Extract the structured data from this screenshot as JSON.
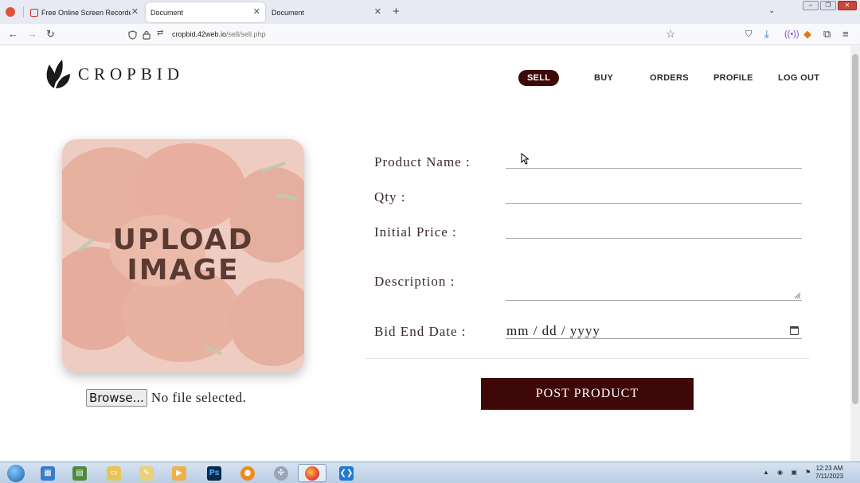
{
  "browser": {
    "tabs": [
      {
        "label": "Free Online Screen Recorder & ...",
        "active": false
      },
      {
        "label": "Document",
        "active": true
      },
      {
        "label": "Document",
        "active": false
      }
    ],
    "url_host": "cropbid.42web.io",
    "url_path": "/sell/sell.php"
  },
  "site": {
    "brand": "CROPBID",
    "nav": [
      {
        "label": "SELL",
        "active": true
      },
      {
        "label": "BUY",
        "active": false
      },
      {
        "label": "ORDERS",
        "active": false
      },
      {
        "label": "PROFILE",
        "active": false
      },
      {
        "label": "LOG OUT",
        "active": false
      }
    ]
  },
  "upload": {
    "line1": "UPLOAD",
    "line2": "IMAGE",
    "browse_label": "Browse...",
    "file_status": "No file selected."
  },
  "form": {
    "product_name_label": "Product Name :",
    "qty_label": "Qty :",
    "initial_price_label": "Initial Price :",
    "description_label": "Description :",
    "bid_end_date_label": "Bid End Date :",
    "date_placeholder": "mm / dd / yyyy",
    "submit_label": "POST PRODUCT"
  },
  "taskbar": {
    "time": "12:23 AM",
    "date": "7/11/2023"
  },
  "colors": {
    "accent": "#3f0808",
    "label_text": "#3a2a27"
  }
}
